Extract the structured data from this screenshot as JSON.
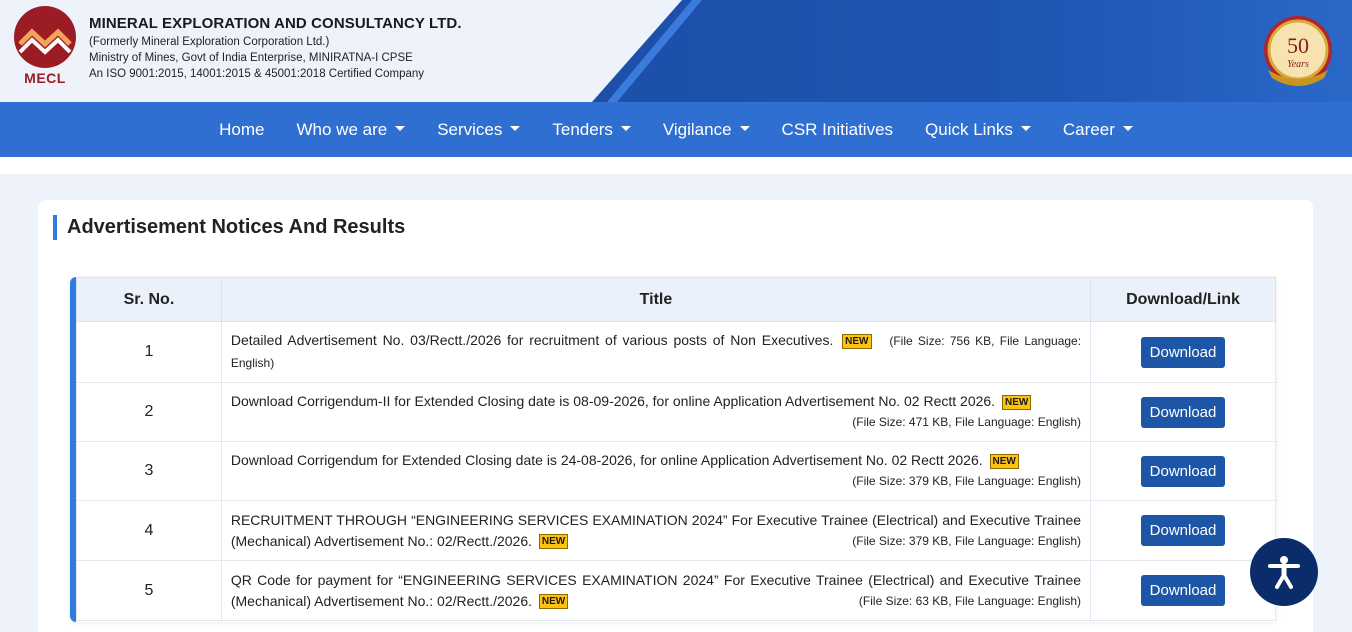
{
  "header": {
    "logo_text": "MECL",
    "org_name": "MINERAL EXPLORATION AND CONSULTANCY LTD.",
    "formerly": "(Formerly Mineral Exploration Corporation Ltd.)",
    "ministry": "Ministry of Mines, Govt of India Enterprise, MINIRATNA-I CPSE",
    "iso": "An ISO 9001:2015, 14001:2015 & 45001:2018 Certified Company",
    "badge_text": "50",
    "badge_sub": "Years"
  },
  "nav": {
    "items": [
      {
        "label": "Home"
      },
      {
        "label": "Who we are"
      },
      {
        "label": "Services"
      },
      {
        "label": "Tenders"
      },
      {
        "label": "Vigilance"
      },
      {
        "label": "CSR Initiatives"
      },
      {
        "label": "Quick Links"
      },
      {
        "label": "Career"
      }
    ]
  },
  "section": {
    "title": "Advertisement Notices And Results"
  },
  "table": {
    "headers": [
      "Sr. No.",
      "Title",
      "Download/Link"
    ],
    "new_label": "NEW",
    "download_label": "Download",
    "rows": [
      {
        "sr": "1",
        "title": "Detailed Advertisement No. 03/Rectt./2026 for recruitment of various posts of Non Executives.",
        "meta": "(File Size: 756 KB, File Language: English)"
      },
      {
        "sr": "2",
        "title": "Download Corrigendum-II for Extended Closing date is 08-09-2026, for online Application Advertisement No. 02 Rectt 2026.",
        "meta": "(File Size: 471 KB, File Language: English)"
      },
      {
        "sr": "3",
        "title": "Download Corrigendum for Extended Closing date is 24-08-2026, for online Application Advertisement No. 02 Rectt 2026.",
        "meta": "(File Size: 379 KB, File Language: English)"
      },
      {
        "sr": "4",
        "title": "RECRUITMENT THROUGH “ENGINEERING SERVICES EXAMINATION 2024” For Executive Trainee (Electrical) and Executive Trainee (Mechanical) Advertisement No.: 02/Rectt./2026.",
        "meta": "(File Size: 379 KB, File Language: English)"
      },
      {
        "sr": "5",
        "title": "QR Code for payment for “ENGINEERING SERVICES EXAMINATION 2024” For Executive Trainee (Electrical) and Executive Trainee (Mechanical) Advertisement No.: 02/Rectt./2026.",
        "meta": "(File Size: 63 KB, File Language: English)"
      }
    ]
  },
  "colors": {
    "nav_bg": "#2f6fd2",
    "accent": "#2f7be0",
    "button": "#1d56a6",
    "new_badge": "#ffc30f",
    "logo": "#9b1c25"
  }
}
